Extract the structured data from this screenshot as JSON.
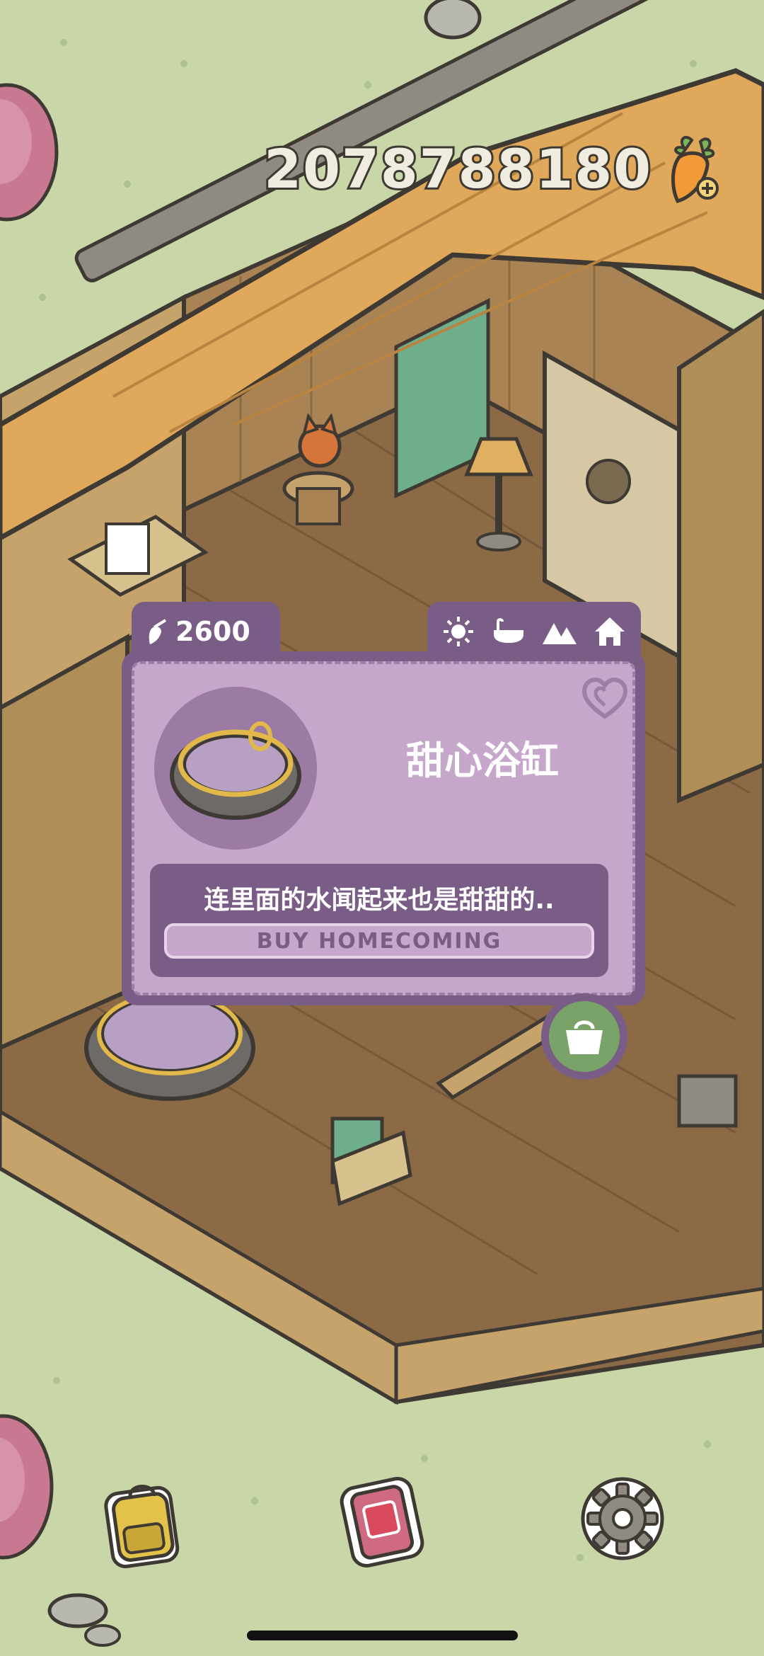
{
  "hud": {
    "currency_amount": "2078788180",
    "currency_icon": "carrot-plus-icon"
  },
  "popup": {
    "price": "2600",
    "price_icon": "carrot-icon",
    "category_tabs": [
      "sun-icon",
      "bathtub-icon",
      "mountain-icon",
      "house-icon"
    ],
    "item_name": "甜心浴缸",
    "description": "连里面的水闻起来也是甜甜的..",
    "buy_label": "BUY HOMECOMING"
  },
  "actions": {
    "shop_bag_icon": "shopping-bag-icon"
  },
  "bottom_bar": {
    "items": [
      "backpack-icon",
      "phone-icon",
      "settings-gear-icon"
    ]
  },
  "colors": {
    "grass": "#c9d6a8",
    "popup_dark": "#7a5d86",
    "popup_light": "#c7a6cc",
    "floor_wood": "#8c6a46",
    "roof": "#e0a85a"
  }
}
